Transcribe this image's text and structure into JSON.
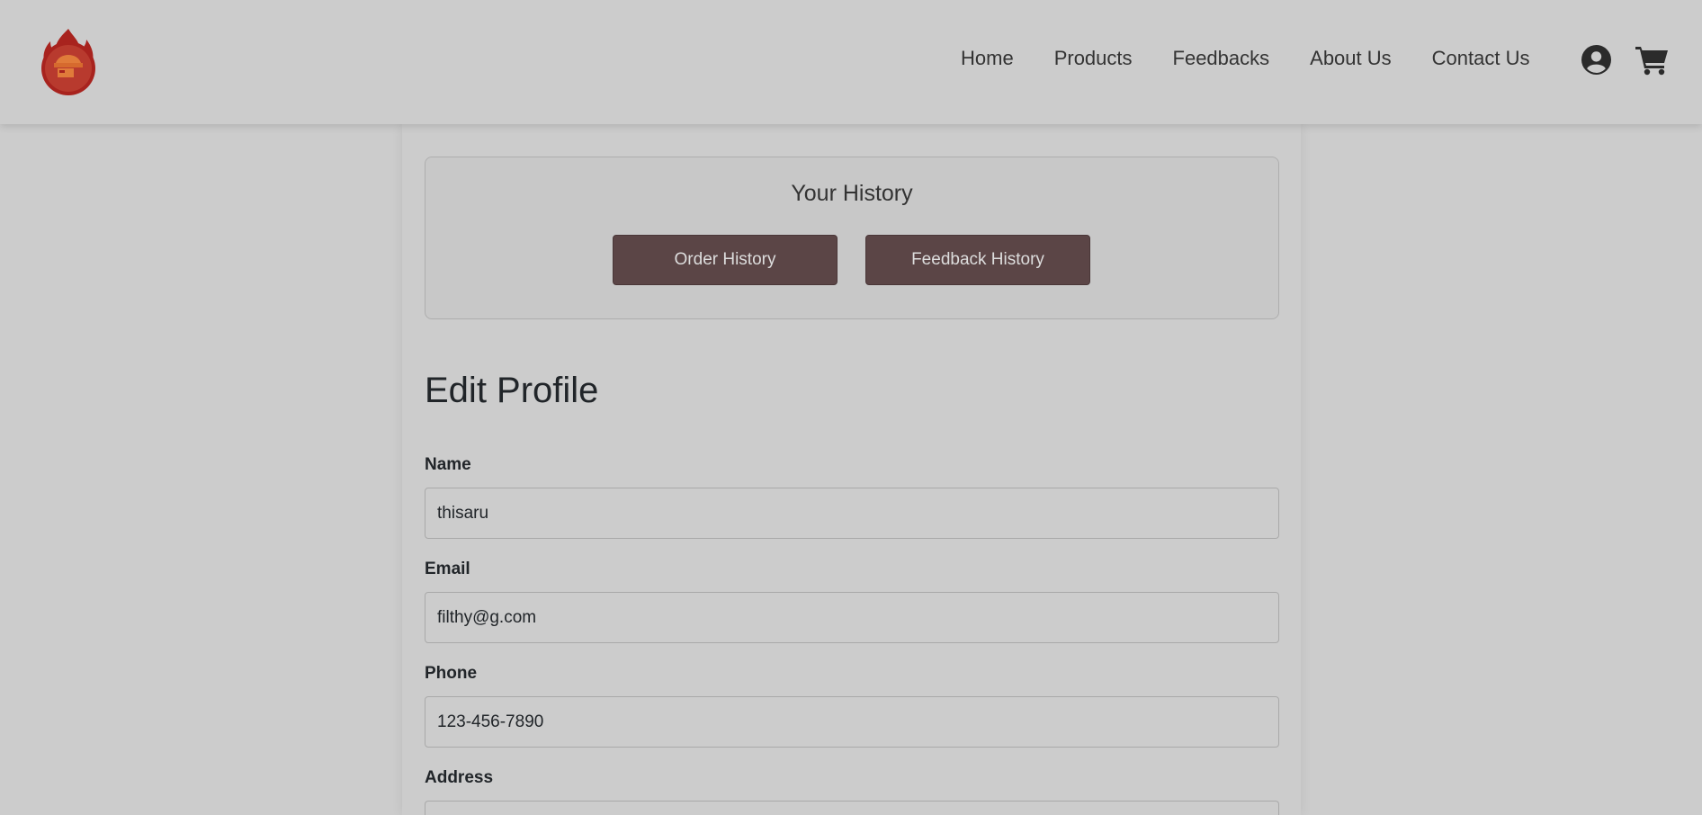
{
  "nav": {
    "links": [
      "Home",
      "Products",
      "Feedbacks",
      "About Us",
      "Contact Us"
    ],
    "icons": {
      "user": "user-circle-icon",
      "cart": "shopping-cart-icon"
    },
    "logo": "flame-chef-logo"
  },
  "history": {
    "title": "Your History",
    "order_button": "Order History",
    "feedback_button": "Feedback History"
  },
  "profile": {
    "title": "Edit Profile",
    "fields": [
      {
        "label": "Name",
        "value": "thisaru"
      },
      {
        "label": "Email",
        "value": "filthy@g.com"
      },
      {
        "label": "Phone",
        "value": "123-456-7890"
      },
      {
        "label": "Address",
        "value": ""
      }
    ]
  },
  "colors": {
    "background": "#cccccc",
    "button": "#5b4546",
    "logo_red": "#a8231e",
    "logo_orange": "#e07b3a"
  }
}
